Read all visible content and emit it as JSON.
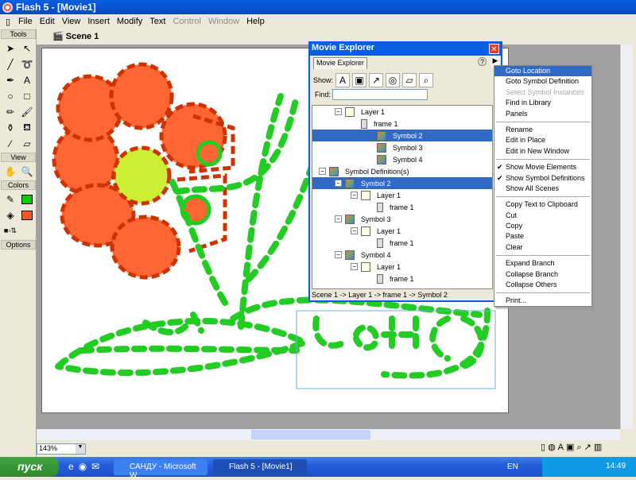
{
  "window": {
    "title": "Flash 5 - [Movie1]"
  },
  "menu": [
    {
      "label": "File"
    },
    {
      "label": "Edit"
    },
    {
      "label": "View"
    },
    {
      "label": "Insert"
    },
    {
      "label": "Modify"
    },
    {
      "label": "Text"
    },
    {
      "label": "Control",
      "disabled": true
    },
    {
      "label": "Window",
      "disabled": true
    },
    {
      "label": "Help"
    }
  ],
  "scene": "Scene 1",
  "tools": {
    "header": "Tools",
    "view": "View",
    "colors": "Colors",
    "options": "Options",
    "stroke_color": "#00cc00",
    "fill_color": "#ff5522"
  },
  "zoom": "143%",
  "explorer": {
    "title": "Movie Explorer",
    "tab": "Movie Explorer",
    "show_label": "Show:",
    "find_label": "Find:",
    "find_value": "",
    "tree": [
      {
        "label": "Layer 1",
        "icon": "layer",
        "depth": 1
      },
      {
        "label": "frame 1",
        "icon": "frame",
        "depth": 2
      },
      {
        "label": "Symbol 2",
        "icon": "symbol",
        "depth": 3,
        "selected": true
      },
      {
        "label": "Symbol 3",
        "icon": "symbol",
        "depth": 3
      },
      {
        "label": "Symbol 4",
        "icon": "symbol",
        "depth": 3
      },
      {
        "label": "Symbol Definition(s)",
        "icon": "symdef",
        "depth": 0
      },
      {
        "label": "Symbol 2",
        "icon": "symbol",
        "depth": 1,
        "selected": true
      },
      {
        "label": "Layer 1",
        "icon": "layer",
        "depth": 2
      },
      {
        "label": "frame 1",
        "icon": "frame",
        "depth": 3
      },
      {
        "label": "Symbol 3",
        "icon": "symbol",
        "depth": 1
      },
      {
        "label": "Layer 1",
        "icon": "layer",
        "depth": 2
      },
      {
        "label": "frame 1",
        "icon": "frame",
        "depth": 3
      },
      {
        "label": "Symbol 4",
        "icon": "symbol",
        "depth": 1
      },
      {
        "label": "Layer 1",
        "icon": "layer",
        "depth": 2
      },
      {
        "label": "frame 1",
        "icon": "frame",
        "depth": 3
      }
    ],
    "status": "Scene 1 -> Layer 1 -> frame 1 -> Symbol 2"
  },
  "context_menu": [
    [
      {
        "label": "Goto Location",
        "highlighted": true
      },
      {
        "label": "Goto Symbol Definition"
      },
      {
        "label": "Select Symbol Instances",
        "disabled": true
      },
      {
        "label": "Find in Library"
      },
      {
        "label": "Panels"
      }
    ],
    [
      {
        "label": "Rename"
      },
      {
        "label": "Edit in Place"
      },
      {
        "label": "Edit in New Window"
      }
    ],
    [
      {
        "label": "Show Movie Elements",
        "checked": true
      },
      {
        "label": "Show Symbol Definitions",
        "checked": true
      },
      {
        "label": "Show All Scenes"
      }
    ],
    [
      {
        "label": "Copy Text to Clipboard"
      },
      {
        "label": "Cut"
      },
      {
        "label": "Copy"
      },
      {
        "label": "Paste"
      },
      {
        "label": "Clear"
      }
    ],
    [
      {
        "label": "Expand Branch"
      },
      {
        "label": "Collapse Branch"
      },
      {
        "label": "Collapse Others"
      }
    ],
    [
      {
        "label": "Print..."
      }
    ]
  ],
  "taskbar": {
    "start": "пуск",
    "tasks": [
      "САНДУ - Microsoft W...",
      "Flash 5 - [Movie1]"
    ],
    "lang": "EN",
    "clock": "14:49"
  }
}
